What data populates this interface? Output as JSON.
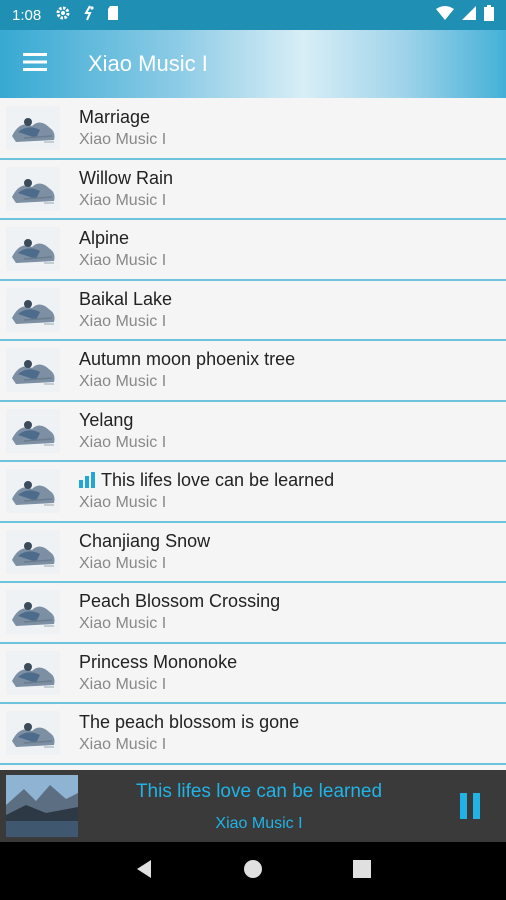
{
  "status_bar": {
    "time": "1:08",
    "left_icons": [
      "gear-icon",
      "activity-icon",
      "sd-card-icon"
    ],
    "right_icons": [
      "wifi-icon",
      "signal-icon",
      "battery-icon"
    ]
  },
  "app_bar": {
    "title": "Xiao Music I",
    "menu_icon": "hamburger-icon"
  },
  "songs": [
    {
      "title": "Marriage",
      "artist": "Xiao Music I",
      "playing": false
    },
    {
      "title": "Willow Rain",
      "artist": "Xiao Music I",
      "playing": false
    },
    {
      "title": "Alpine",
      "artist": "Xiao Music I",
      "playing": false
    },
    {
      "title": "Baikal Lake",
      "artist": "Xiao Music I",
      "playing": false
    },
    {
      "title": "Autumn moon phoenix tree",
      "artist": "Xiao Music I",
      "playing": false
    },
    {
      "title": "Yelang",
      "artist": "Xiao Music I",
      "playing": false
    },
    {
      "title": "This lifes love can be learned",
      "artist": "Xiao Music I",
      "playing": true
    },
    {
      "title": "Chanjiang Snow",
      "artist": "Xiao Music I",
      "playing": false
    },
    {
      "title": "Peach Blossom Crossing",
      "artist": "Xiao Music I",
      "playing": false
    },
    {
      "title": "Princess Mononoke",
      "artist": "Xiao Music I",
      "playing": false
    },
    {
      "title": "The peach blossom is gone",
      "artist": "Xiao Music I",
      "playing": false
    }
  ],
  "now_playing": {
    "title": "This lifes love can be learned",
    "artist": "Xiao Music I",
    "control_icon": "pause-icon"
  },
  "nav_bar": {
    "buttons": [
      "back-icon",
      "home-icon",
      "recents-icon"
    ]
  },
  "colors": {
    "accent": "#22b3e6",
    "divider": "#6ec3df",
    "status_bar": "#1f8fb3",
    "player_bg": "#3a3a3a"
  }
}
